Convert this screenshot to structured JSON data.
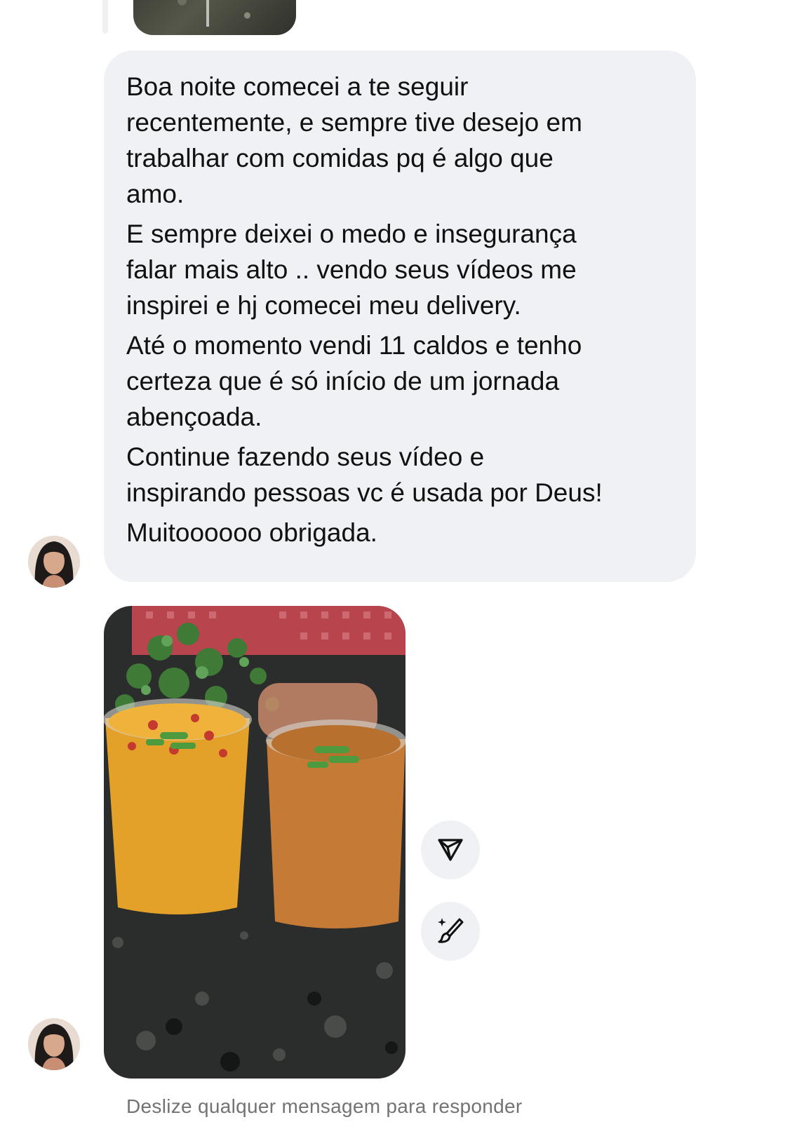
{
  "message": {
    "paragraphs": [
      "Boa noite comecei a te seguir\nrecentemente, e sempre tive desejo em\ntrabalhar com comidas pq é algo que\namo.",
      "E sempre deixei o medo e insegurança\nfalar mais alto .. vendo seus vídeos me\ninspirei e hj comecei meu delivery.",
      "Até o momento vendi 11 caldos e tenho\ncerteza que é só início de um jornada\nabençoada.",
      "Continue fazendo seus vídeo e\ninspirando pessoas vc é usada por Deus!",
      "Muitoooooo obrigada."
    ]
  },
  "actions": {
    "share_icon": "send-icon",
    "edit_icon": "ai-brush-icon"
  },
  "footer": {
    "hint": "Deslize qualquer mensagem para responder"
  },
  "colors": {
    "bubble": "#eff1f4",
    "text": "#111111",
    "hint": "#737373"
  }
}
